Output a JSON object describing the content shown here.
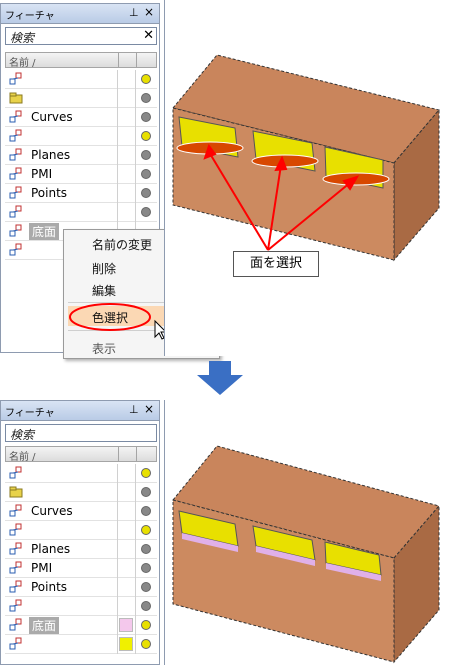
{
  "top": {
    "panel": {
      "title": "フィーチャ",
      "pin_icon": "pin-icon",
      "close_icon": "close-icon",
      "search_placeholder": "検索",
      "header_label": "名前 /",
      "rows": [
        {
          "label": "",
          "icon": "feature-icon",
          "dot": "#e8e000"
        },
        {
          "label": "",
          "icon": "folder-icon",
          "dot": "#888888"
        },
        {
          "label": "Curves",
          "icon": "feature-icon",
          "dot": "#888888"
        },
        {
          "label": "",
          "icon": "feature-icon",
          "dot": "#e8e000"
        },
        {
          "label": "Planes",
          "icon": "feature-icon",
          "dot": "#888888"
        },
        {
          "label": "PMI",
          "icon": "feature-icon",
          "dot": "#888888"
        },
        {
          "label": "Points",
          "icon": "feature-icon",
          "dot": "#888888"
        },
        {
          "label": "",
          "icon": "feature-icon",
          "dot": "#888888"
        },
        {
          "label": "底面",
          "icon": "feature-icon",
          "dot": ""
        },
        {
          "label": "",
          "icon": "feature-icon",
          "dot": ""
        }
      ]
    },
    "context_menu": {
      "items": [
        "名前の変更",
        "削除",
        "編集",
        "色選択",
        "表示"
      ],
      "highlighted": "色選択"
    },
    "callout": "面を選択"
  },
  "bottom": {
    "panel": {
      "title": "フィーチャ",
      "search_placeholder": "検索",
      "header_label": "名前 /",
      "rows": [
        {
          "label": "",
          "icon": "feature-icon",
          "dot": "#e8e000",
          "swatch": ""
        },
        {
          "label": "",
          "icon": "folder-icon",
          "dot": "#888888",
          "swatch": ""
        },
        {
          "label": "Curves",
          "icon": "feature-icon",
          "dot": "#888888",
          "swatch": ""
        },
        {
          "label": "",
          "icon": "feature-icon",
          "dot": "#e8e000",
          "swatch": ""
        },
        {
          "label": "Planes",
          "icon": "feature-icon",
          "dot": "#888888",
          "swatch": ""
        },
        {
          "label": "PMI",
          "icon": "feature-icon",
          "dot": "#888888",
          "swatch": ""
        },
        {
          "label": "Points",
          "icon": "feature-icon",
          "dot": "#888888",
          "swatch": ""
        },
        {
          "label": "",
          "icon": "feature-icon",
          "dot": "#888888",
          "swatch": ""
        },
        {
          "label": "底面",
          "icon": "feature-icon",
          "dot": "#e8e000",
          "swatch": "#f4c8ec"
        },
        {
          "label": "",
          "icon": "feature-icon",
          "dot": "#e8e000",
          "swatch": "#f0f000"
        }
      ]
    }
  },
  "colors": {
    "box": "#c8855a",
    "pocket_wall": "#e8e000",
    "selected_face": "#d84800",
    "colored_face": "#e0b0e8",
    "annotation": "#ff0000",
    "arrow_down": "#3a6fc4"
  }
}
